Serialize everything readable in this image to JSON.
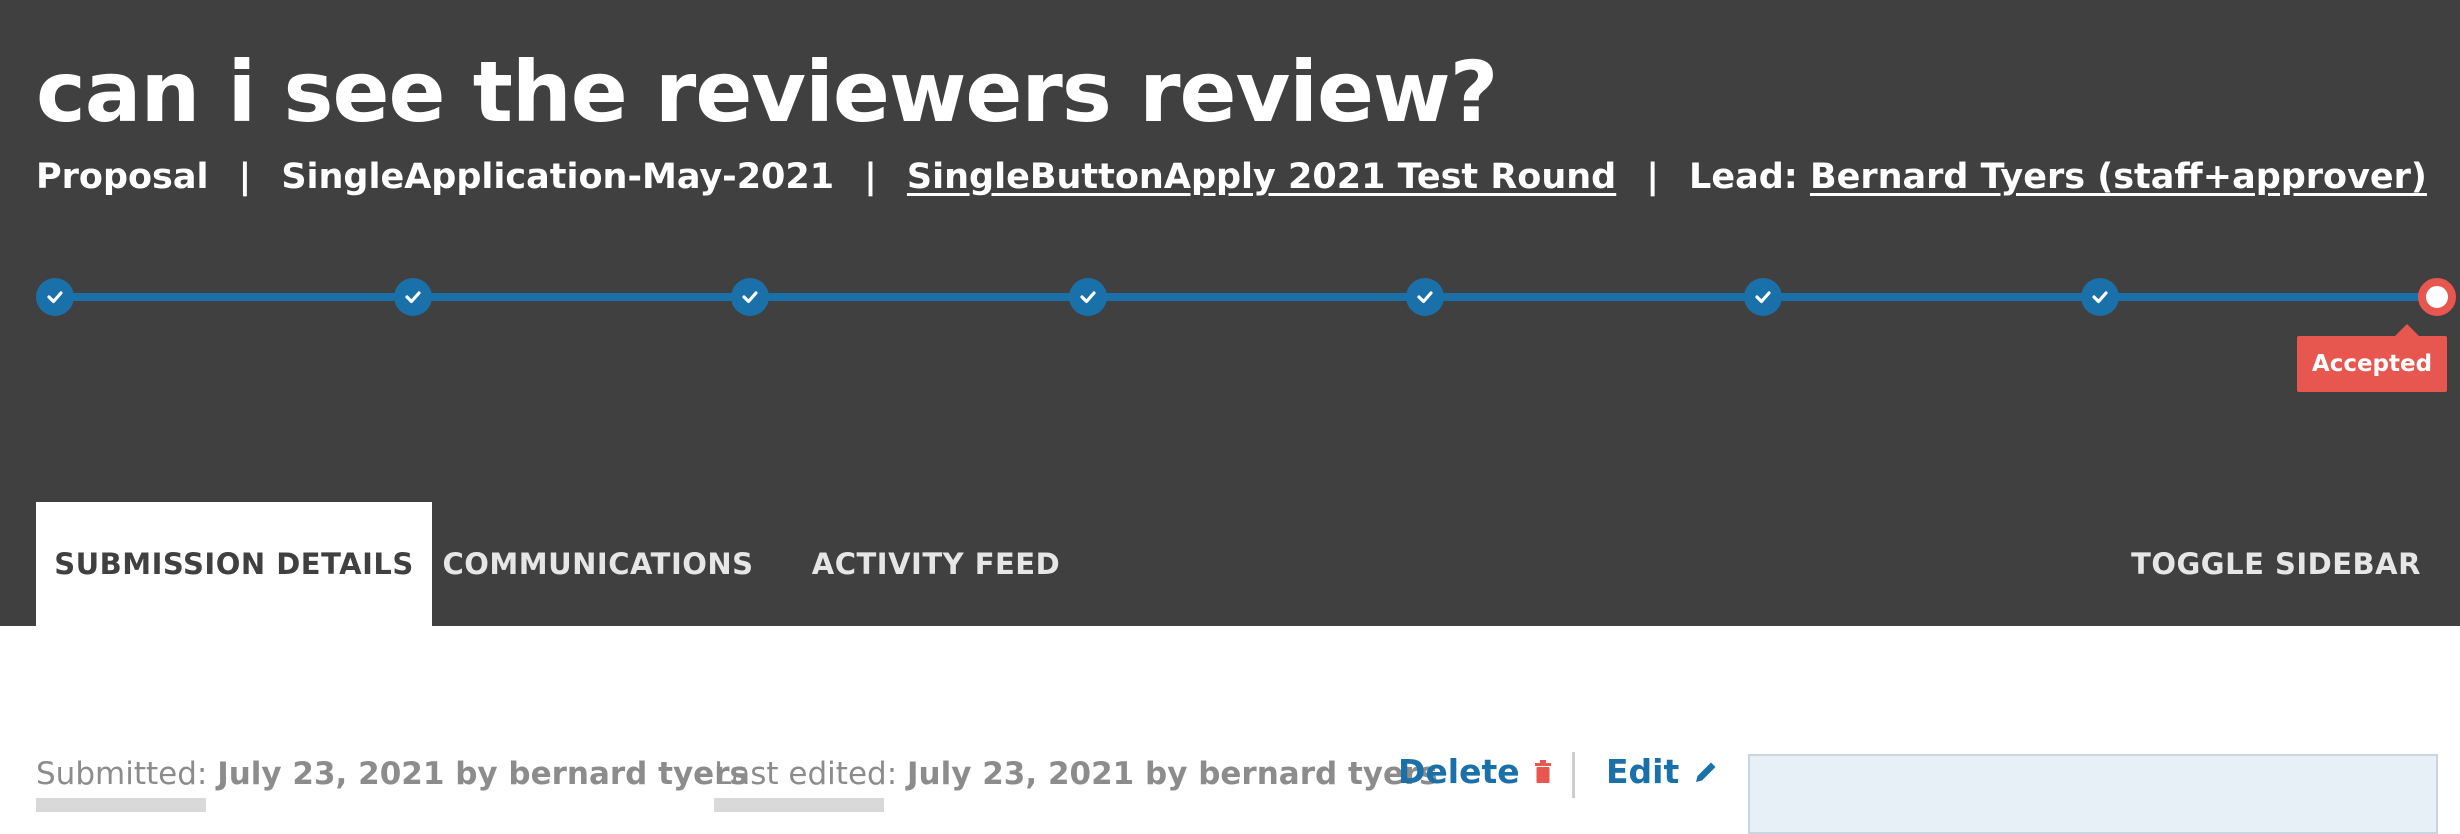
{
  "header": {
    "title": "can i see the reviewers review?",
    "meta": {
      "type": "Proposal",
      "form": "SingleApplication-May-2021",
      "round": "SingleButtonApply 2021 Test Round",
      "lead_label": "Lead:",
      "lead_name": "Bernard Tyers (staff+approver)",
      "separator": "|"
    }
  },
  "progress": {
    "steps_completed": 7,
    "current_status": "Accepted",
    "colors": {
      "complete": "#1a70a8",
      "current": "#e8574f"
    }
  },
  "tabs": [
    {
      "label": "SUBMISSION DETAILS",
      "active": true
    },
    {
      "label": "COMMUNICATIONS",
      "active": false
    },
    {
      "label": "ACTIVITY FEED",
      "active": false
    }
  ],
  "toggle_sidebar": "TOGGLE SIDEBAR",
  "submission": {
    "submitted_label": "Submitted:",
    "submitted_value": "July 23, 2021 by bernard tyers",
    "edited_label": "Last edited:",
    "edited_value": "July 23, 2021 by bernard tyers",
    "delete_label": "Delete",
    "edit_label": "Edit"
  }
}
